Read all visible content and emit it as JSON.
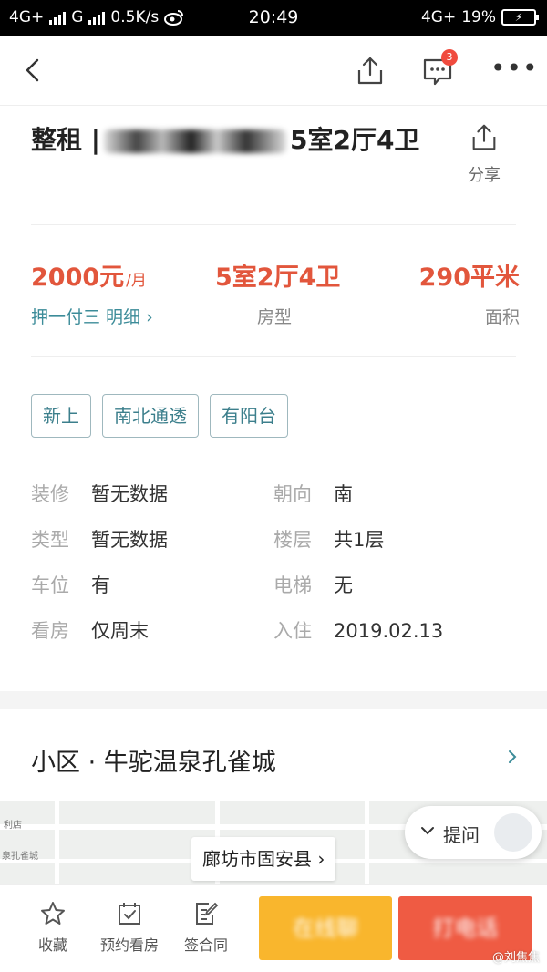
{
  "status_bar": {
    "network1": "4G+",
    "network2": "G",
    "speed": "0.5K/s",
    "time": "20:49",
    "network3": "4G+",
    "battery": "19%"
  },
  "nav": {
    "badge_count": "3"
  },
  "listing": {
    "title_prefix": "整租 |",
    "title_suffix": "5室2厅4卫",
    "share_label": "分享",
    "price_value": "2000元",
    "price_unit": "/月",
    "price_terms": "押一付三 明细 ›",
    "layout_value": "5室2厅4卫",
    "layout_label": "房型",
    "area_value": "290平米",
    "area_label": "面积"
  },
  "tags": [
    "新上",
    "南北通透",
    "有阳台"
  ],
  "attributes": [
    {
      "key": "装修",
      "value": "暂无数据"
    },
    {
      "key": "朝向",
      "value": "南"
    },
    {
      "key": "类型",
      "value": "暂无数据"
    },
    {
      "key": "楼层",
      "value": "共1层"
    },
    {
      "key": "车位",
      "value": "有"
    },
    {
      "key": "电梯",
      "value": "无"
    },
    {
      "key": "看房",
      "value": "仅周末"
    },
    {
      "key": "入住",
      "value": "2019.02.13"
    }
  ],
  "community": {
    "label": "小区 · 牛驼温泉孔雀城"
  },
  "map": {
    "location_label": "廊坊市固安县 ›",
    "ask_label": "提问",
    "small_text_1": "利店",
    "small_text_2": "泉孔雀城"
  },
  "bottom_bar": {
    "favorite_label": "收藏",
    "schedule_label": "预约看房",
    "contract_label": "签合同",
    "online_button": "在线聊",
    "call_button": "打电话",
    "watermark": "@刘焦焦"
  },
  "colors": {
    "accent_price": "#e2563c",
    "accent_teal": "#3c7f8c",
    "cta_yellow": "#f9b62d",
    "cta_red": "#ef5b43"
  }
}
